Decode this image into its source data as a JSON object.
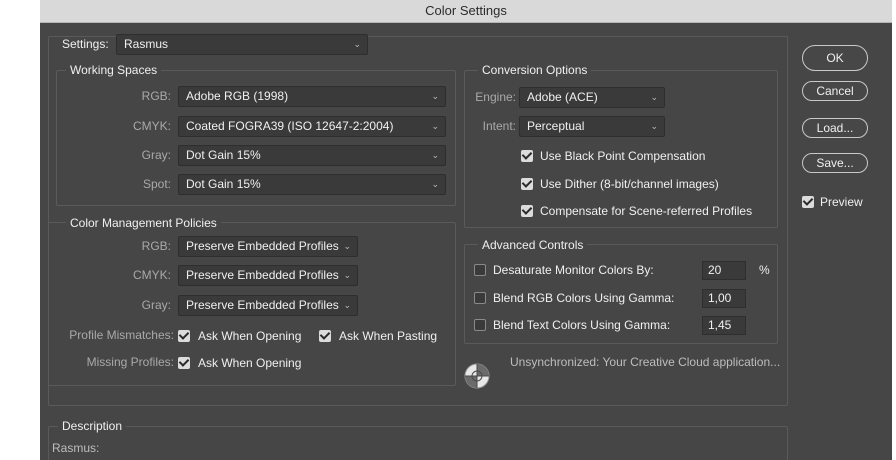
{
  "window": {
    "title": "Color Settings"
  },
  "settings": {
    "label": "Settings:",
    "value": "Rasmus"
  },
  "working_spaces": {
    "legend": "Working Spaces",
    "rows": [
      {
        "label": "RGB:",
        "value": "Adobe RGB (1998)"
      },
      {
        "label": "CMYK:",
        "value": "Coated FOGRA39 (ISO 12647-2:2004)"
      },
      {
        "label": "Gray:",
        "value": "Dot Gain 15%"
      },
      {
        "label": "Spot:",
        "value": "Dot Gain 15%"
      }
    ]
  },
  "policies": {
    "legend": "Color Management Policies",
    "rows": [
      {
        "label": "RGB:",
        "value": "Preserve Embedded Profiles"
      },
      {
        "label": "CMYK:",
        "value": "Preserve Embedded Profiles"
      },
      {
        "label": "Gray:",
        "value": "Preserve Embedded Profiles"
      }
    ],
    "mismatch_label": "Profile Mismatches:",
    "ask_opening": "Ask When Opening",
    "ask_pasting": "Ask When Pasting",
    "missing_label": "Missing Profiles:",
    "missing_ask_opening": "Ask When Opening"
  },
  "conversion": {
    "legend": "Conversion Options",
    "engine_label": "Engine:",
    "engine_value": "Adobe (ACE)",
    "intent_label": "Intent:",
    "intent_value": "Perceptual",
    "black_point": "Use Black Point Compensation",
    "dither": "Use Dither (8-bit/channel images)",
    "scene_referred": "Compensate for Scene-referred Profiles"
  },
  "advanced": {
    "legend": "Advanced Controls",
    "desaturate_label": "Desaturate Monitor Colors By:",
    "desaturate_value": "20",
    "desaturate_unit": "%",
    "blend_rgb_label": "Blend RGB Colors Using Gamma:",
    "blend_rgb_value": "1,00",
    "blend_text_label": "Blend Text Colors Using Gamma:",
    "blend_text_value": "1,45"
  },
  "sync": {
    "text": "Unsynchronized: Your Creative Cloud application..."
  },
  "description": {
    "legend": "Description",
    "text": "Rasmus:"
  },
  "buttons": {
    "ok": "OK",
    "cancel": "Cancel",
    "load": "Load...",
    "save": "Save...",
    "preview": "Preview"
  }
}
